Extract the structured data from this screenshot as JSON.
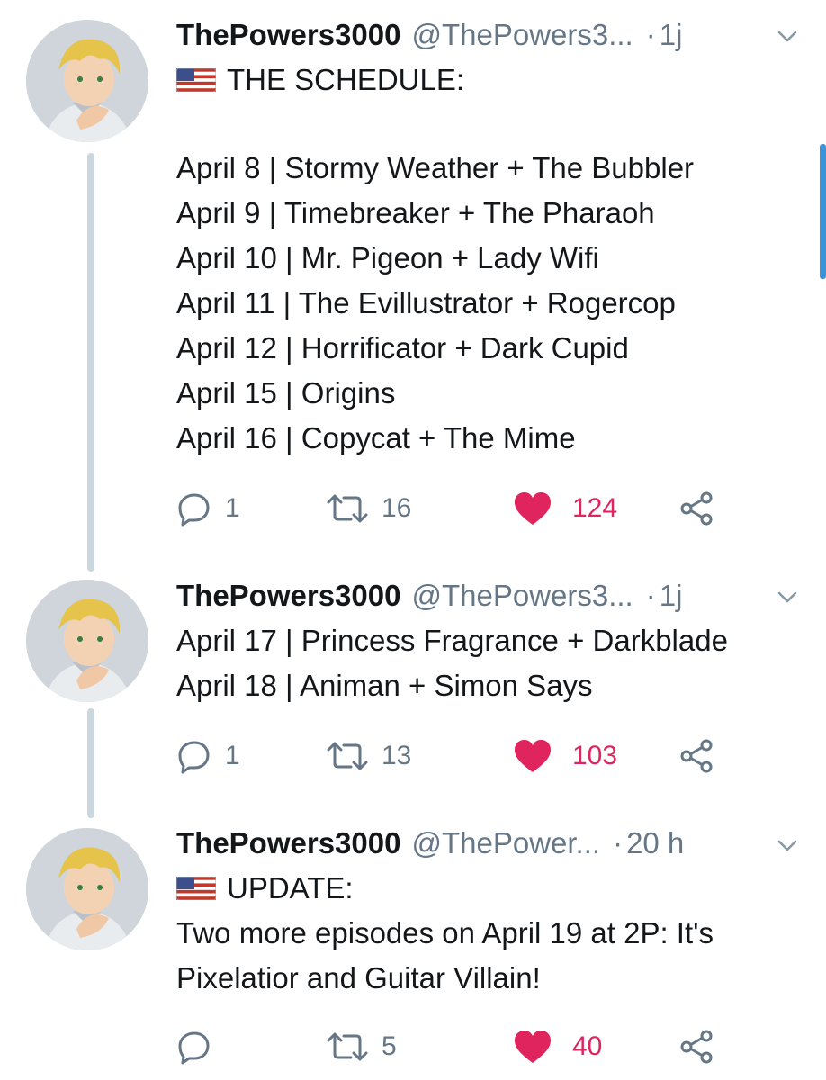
{
  "tweets": [
    {
      "name": "ThePowers3000",
      "handle": "@ThePowers3...",
      "dot": "·",
      "time": "1j",
      "lines": [
        "THE SCHEDULE:",
        "",
        "April 8 | Stormy Weather + The Bubbler",
        "April 9 | Timebreaker + The Pharaoh",
        "April 10 | Mr. Pigeon + Lady Wifi",
        "April 11 | The Evillustrator + Rogercop",
        "April 12 | Horrificator + Dark Cupid",
        "April 15 | Origins",
        "April 16 | Copycat + The Mime"
      ],
      "replies": "1",
      "retweets": "16",
      "likes": "124"
    },
    {
      "name": "ThePowers3000",
      "handle": "@ThePowers3...",
      "dot": "·",
      "time": "1j",
      "lines": [
        "April 17 | Princess Fragrance + Darkblade",
        "April 18 | Animan + Simon Says"
      ],
      "replies": "1",
      "retweets": "13",
      "likes": "103"
    },
    {
      "name": "ThePowers3000",
      "handle": "@ThePower...",
      "dot": "·",
      "time": "20 h",
      "lines": [
        "UPDATE:",
        "Two more episodes on April 19 at 2P: It's",
        "Pixelatior and Guitar Villain!"
      ],
      "replies": "",
      "retweets": "5",
      "likes": "40"
    }
  ],
  "colors": {
    "like": "#e0245e",
    "muted": "#657786",
    "text": "#14171a",
    "thread": "#ccd6dd",
    "scrollbar": "#3b94d9"
  },
  "icons": [
    "us-flag-icon",
    "chevron-down-icon",
    "reply-icon",
    "retweet-icon",
    "heart-icon",
    "share-icon"
  ]
}
